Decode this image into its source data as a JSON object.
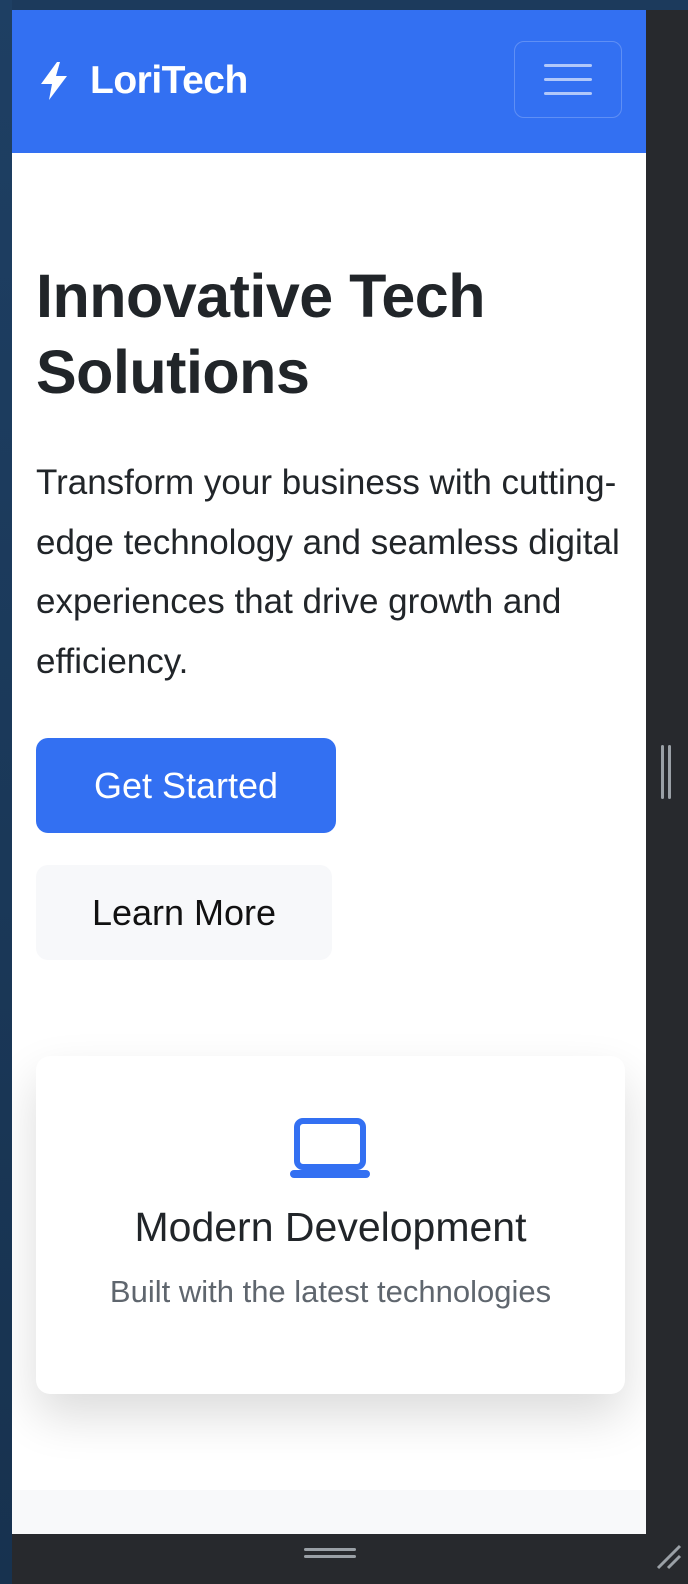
{
  "navbar": {
    "brand": "LoriTech",
    "brand_icon": "lightning-bolt-icon",
    "toggler_icon": "hamburger-menu-icon",
    "color": "#3370f2"
  },
  "hero": {
    "title_line1": "Innovative Tech",
    "title_line2": "Solutions",
    "text": "Transform your business with cutting-edge technology and seamless digital experiences that drive growth and efficiency.",
    "primary_button": "Get Started",
    "secondary_button": "Learn More"
  },
  "feature": {
    "icon": "laptop-icon",
    "title": "Modern Development",
    "text": "Built with the latest technologies"
  }
}
